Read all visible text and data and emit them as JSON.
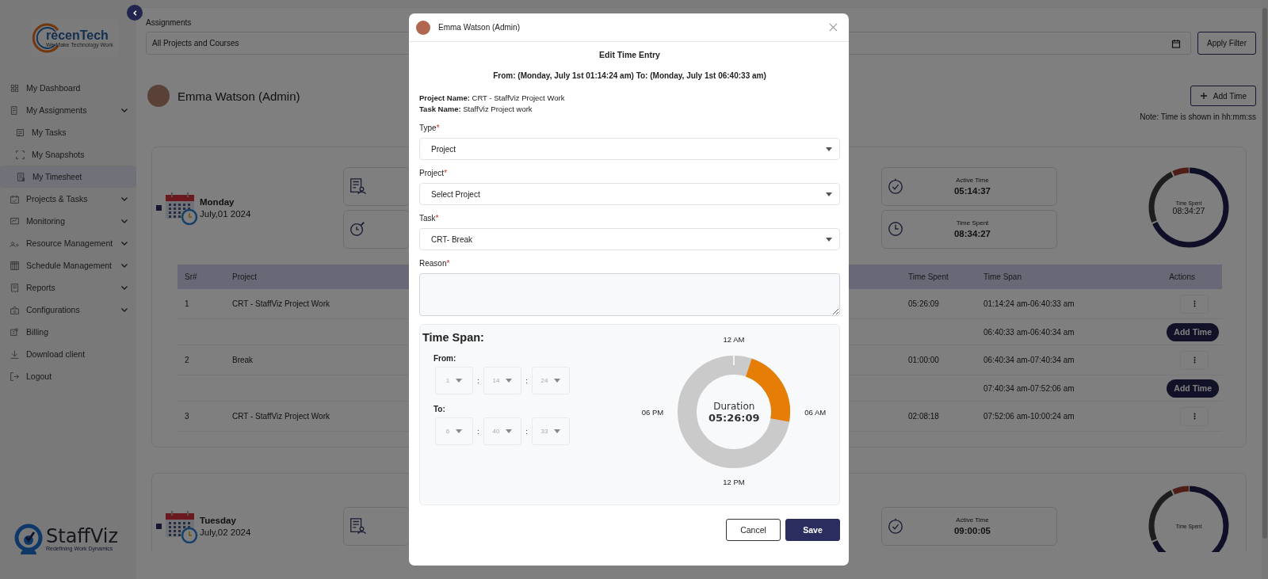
{
  "sidebar": {
    "logo": {
      "mark": "recenTech",
      "tagline": "We Make Technology Work"
    },
    "items": [
      {
        "label": "My Dashboard",
        "expandable": false,
        "selected": false
      },
      {
        "label": "My Assignments",
        "expandable": true,
        "selected": false,
        "children": [
          {
            "label": "My Tasks",
            "selected": false
          },
          {
            "label": "My Snapshots",
            "selected": false
          },
          {
            "label": "My Timesheet",
            "selected": true
          }
        ]
      },
      {
        "label": "Projects & Tasks",
        "expandable": true,
        "selected": false
      },
      {
        "label": "Monitoring",
        "expandable": true,
        "selected": false
      },
      {
        "label": "Resource Management",
        "expandable": true,
        "selected": false
      },
      {
        "label": "Schedule Management",
        "expandable": true,
        "selected": false
      },
      {
        "label": "Reports",
        "expandable": true,
        "selected": false
      },
      {
        "label": "Configurations",
        "expandable": true,
        "selected": false
      },
      {
        "label": "Billing",
        "expandable": false,
        "selected": false
      },
      {
        "label": "Download client",
        "expandable": false,
        "selected": false
      },
      {
        "label": "Logout",
        "expandable": false,
        "selected": false
      }
    ],
    "footer_logo": {
      "name": "StaffViz",
      "tagline": "Redefining Work Dynamics"
    }
  },
  "filter": {
    "label": "Assignments",
    "value": "All Projects and Courses",
    "apply_button": "Apply Filter"
  },
  "header": {
    "user_name": "Emma Watson (Admin)",
    "add_time_button": "Add Time",
    "note": "Note: Time is shown in hh:mm:ss"
  },
  "days": [
    {
      "day": "Monday",
      "date": "July,01 2024",
      "stats": [
        {
          "kind": "active",
          "label": "Active Time",
          "value": "05:14:37"
        },
        {
          "kind": "spent",
          "label": "Time Spent",
          "value": "08:34:27"
        }
      ],
      "ring": {
        "label": "Time Spent",
        "value": "08:34:27"
      },
      "table": {
        "columns": [
          "Sr#",
          "Project",
          "Time Spent",
          "Time Span",
          "Actions"
        ],
        "rows": [
          {
            "kind": "entry",
            "sr": "1",
            "project": "CRT - StaffViz Project Work",
            "time_spent": "05:26:09",
            "time_span": "01:14:24 am-06:40:33 am"
          },
          {
            "kind": "gap",
            "time_span": "06:40:33 am-06:40:34 am",
            "button": "Add Time"
          },
          {
            "kind": "entry",
            "sr": "2",
            "project": "Break",
            "time_spent": "01:00:00",
            "time_span": "06:40:34 am-07:40:34 am"
          },
          {
            "kind": "gap",
            "time_span": "07:40:34 am-07:52:06 am",
            "button": "Add Time"
          },
          {
            "kind": "entry",
            "sr": "3",
            "project": "CRT - StaffViz Project Work",
            "time_spent": "02:08:18",
            "time_span": "07:52:06 am-10:00:24 am"
          }
        ]
      }
    },
    {
      "day": "Tuesday",
      "date": "July,02 2024",
      "stats": [
        {
          "kind": "active",
          "label": "Active Time",
          "value": "09:00:05"
        }
      ],
      "ring": {
        "label": "Time Spent"
      }
    }
  ],
  "modal": {
    "user": "Emma Watson (Admin)",
    "title": "Edit Time Entry",
    "range": "From: (Monday, July 1st 01:14:24 am) To: (Monday, July 1st 06:40:33 am)",
    "info": [
      {
        "label": "Project Name:",
        "value": "CRT - StaffViz Project Work"
      },
      {
        "label": "Task Name:",
        "value": "StaffViz Project work"
      }
    ],
    "fields": [
      {
        "kind": "select",
        "label": "Type",
        "required_mark": "*",
        "value": "Project"
      },
      {
        "kind": "select",
        "label": "Project",
        "required_mark": "*",
        "value": "Select Project"
      },
      {
        "kind": "select",
        "label": "Task",
        "required_mark": "*",
        "value": "CRT- Break"
      },
      {
        "kind": "textarea",
        "label": "Reason",
        "required_mark": "*"
      }
    ],
    "time_span": {
      "title": "Time Span:",
      "disabled": true,
      "separator": ":",
      "from": {
        "label": "From:",
        "hour": "1",
        "minute": "14",
        "second": "24"
      },
      "to": {
        "label": "To:",
        "hour": "6",
        "minute": "40",
        "second": "33"
      },
      "dial": {
        "top": "12 AM",
        "right": "06 AM",
        "bottom": "12 PM",
        "left": "06 PM"
      },
      "duration_label": "Duration",
      "duration": "05:26:09"
    },
    "buttons": [
      {
        "kind": "secondary",
        "label": "Cancel"
      },
      {
        "kind": "primary",
        "label": "Save"
      }
    ]
  }
}
